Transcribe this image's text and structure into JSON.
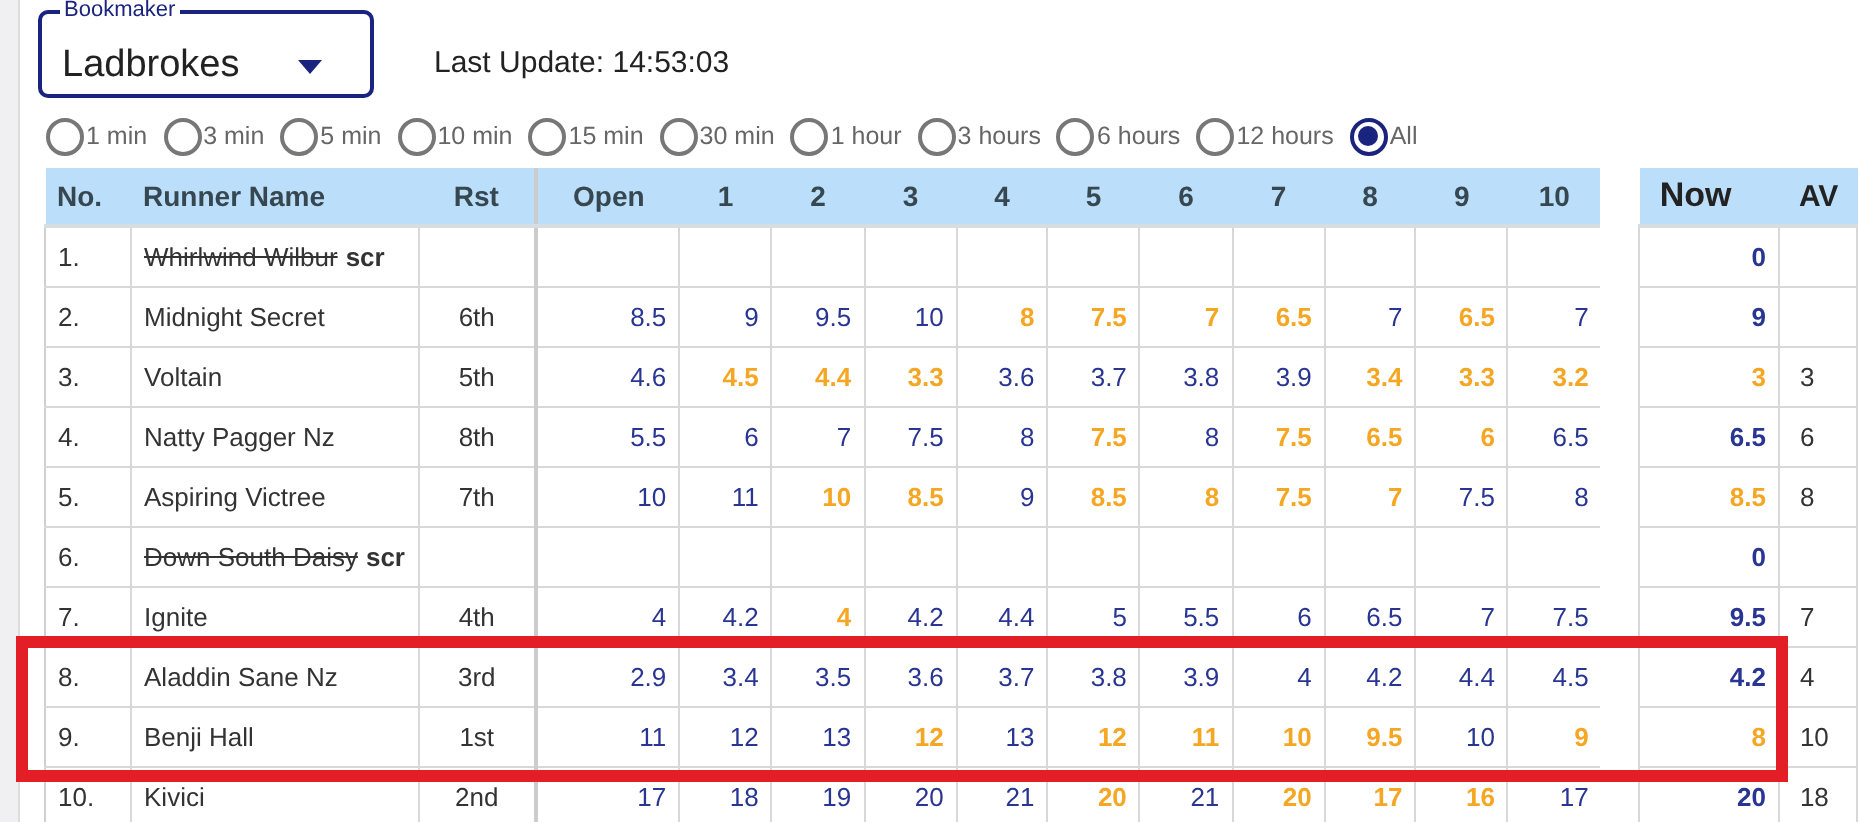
{
  "bookmaker": {
    "label": "Bookmaker",
    "value": "Ladbrokes"
  },
  "last_update": "Last Update: 14:53:03",
  "intervals": [
    {
      "label": "1 min",
      "selected": false
    },
    {
      "label": "3 min",
      "selected": false
    },
    {
      "label": "5 min",
      "selected": false
    },
    {
      "label": "10 min",
      "selected": false
    },
    {
      "label": "15 min",
      "selected": false
    },
    {
      "label": "30 min",
      "selected": false
    },
    {
      "label": "1 hour",
      "selected": false
    },
    {
      "label": "3 hours",
      "selected": false
    },
    {
      "label": "6 hours",
      "selected": false
    },
    {
      "label": "12 hours",
      "selected": false
    },
    {
      "label": "All",
      "selected": true
    }
  ],
  "table": {
    "columns": [
      "No.",
      "Runner Name",
      "Rst",
      "Open",
      "1",
      "2",
      "3",
      "4",
      "5",
      "6",
      "7",
      "8",
      "9",
      "10"
    ],
    "side_columns": [
      "Now",
      "AV"
    ],
    "rows": [
      {
        "no": "1.",
        "name": "Whirlwind Wilbur",
        "scratched": true,
        "scr_label": "scr",
        "rst": "",
        "odds": [],
        "now": {
          "text": "0",
          "highlighted": false
        },
        "av": ""
      },
      {
        "no": "2.",
        "name": "Midnight Secret",
        "scratched": false,
        "rst": "6th",
        "odds": [
          {
            "text": "8.5",
            "highlighted": false
          },
          {
            "text": "9",
            "highlighted": false
          },
          {
            "text": "9.5",
            "highlighted": false
          },
          {
            "text": "10",
            "highlighted": false
          },
          {
            "text": "8",
            "highlighted": true
          },
          {
            "text": "7.5",
            "highlighted": true
          },
          {
            "text": "7",
            "highlighted": true
          },
          {
            "text": "6.5",
            "highlighted": true
          },
          {
            "text": "7",
            "highlighted": false
          },
          {
            "text": "6.5",
            "highlighted": true
          },
          {
            "text": "7",
            "highlighted": false
          }
        ],
        "now": {
          "text": "9",
          "highlighted": false
        },
        "av": ""
      },
      {
        "no": "3.",
        "name": "Voltain",
        "scratched": false,
        "rst": "5th",
        "odds": [
          {
            "text": "4.6",
            "highlighted": false
          },
          {
            "text": "4.5",
            "highlighted": true
          },
          {
            "text": "4.4",
            "highlighted": true
          },
          {
            "text": "3.3",
            "highlighted": true
          },
          {
            "text": "3.6",
            "highlighted": false
          },
          {
            "text": "3.7",
            "highlighted": false
          },
          {
            "text": "3.8",
            "highlighted": false
          },
          {
            "text": "3.9",
            "highlighted": false
          },
          {
            "text": "3.4",
            "highlighted": true
          },
          {
            "text": "3.3",
            "highlighted": true
          },
          {
            "text": "3.2",
            "highlighted": true
          }
        ],
        "now": {
          "text": "3",
          "highlighted": true
        },
        "av": "3"
      },
      {
        "no": "4.",
        "name": "Natty Pagger Nz",
        "scratched": false,
        "rst": "8th",
        "odds": [
          {
            "text": "5.5",
            "highlighted": false
          },
          {
            "text": "6",
            "highlighted": false
          },
          {
            "text": "7",
            "highlighted": false
          },
          {
            "text": "7.5",
            "highlighted": false
          },
          {
            "text": "8",
            "highlighted": false
          },
          {
            "text": "7.5",
            "highlighted": true
          },
          {
            "text": "8",
            "highlighted": false
          },
          {
            "text": "7.5",
            "highlighted": true
          },
          {
            "text": "6.5",
            "highlighted": true
          },
          {
            "text": "6",
            "highlighted": true
          },
          {
            "text": "6.5",
            "highlighted": false
          }
        ],
        "now": {
          "text": "6.5",
          "highlighted": false
        },
        "av": "6"
      },
      {
        "no": "5.",
        "name": "Aspiring Victree",
        "scratched": false,
        "rst": "7th",
        "odds": [
          {
            "text": "10",
            "highlighted": false
          },
          {
            "text": "11",
            "highlighted": false
          },
          {
            "text": "10",
            "highlighted": true
          },
          {
            "text": "8.5",
            "highlighted": true
          },
          {
            "text": "9",
            "highlighted": false
          },
          {
            "text": "8.5",
            "highlighted": true
          },
          {
            "text": "8",
            "highlighted": true
          },
          {
            "text": "7.5",
            "highlighted": true
          },
          {
            "text": "7",
            "highlighted": true
          },
          {
            "text": "7.5",
            "highlighted": false
          },
          {
            "text": "8",
            "highlighted": false
          }
        ],
        "now": {
          "text": "8.5",
          "highlighted": true
        },
        "av": "8"
      },
      {
        "no": "6.",
        "name": "Down South Daisy",
        "scratched": true,
        "scr_label": "scr",
        "rst": "",
        "odds": [],
        "now": {
          "text": "0",
          "highlighted": false
        },
        "av": ""
      },
      {
        "no": "7.",
        "name": "Ignite",
        "scratched": false,
        "rst": "4th",
        "odds": [
          {
            "text": "4",
            "highlighted": false
          },
          {
            "text": "4.2",
            "highlighted": false
          },
          {
            "text": "4",
            "highlighted": true
          },
          {
            "text": "4.2",
            "highlighted": false
          },
          {
            "text": "4.4",
            "highlighted": false
          },
          {
            "text": "5",
            "highlighted": false
          },
          {
            "text": "5.5",
            "highlighted": false
          },
          {
            "text": "6",
            "highlighted": false
          },
          {
            "text": "6.5",
            "highlighted": false
          },
          {
            "text": "7",
            "highlighted": false
          },
          {
            "text": "7.5",
            "highlighted": false
          }
        ],
        "now": {
          "text": "9.5",
          "highlighted": false
        },
        "av": "7"
      },
      {
        "no": "8.",
        "name": "Aladdin Sane Nz",
        "scratched": false,
        "rst": "3rd",
        "odds": [
          {
            "text": "2.9",
            "highlighted": false
          },
          {
            "text": "3.4",
            "highlighted": false
          },
          {
            "text": "3.5",
            "highlighted": false
          },
          {
            "text": "3.6",
            "highlighted": false
          },
          {
            "text": "3.7",
            "highlighted": false
          },
          {
            "text": "3.8",
            "highlighted": false
          },
          {
            "text": "3.9",
            "highlighted": false
          },
          {
            "text": "4",
            "highlighted": false
          },
          {
            "text": "4.2",
            "highlighted": false
          },
          {
            "text": "4.4",
            "highlighted": false
          },
          {
            "text": "4.5",
            "highlighted": false
          }
        ],
        "now": {
          "text": "4.2",
          "highlighted": false
        },
        "av": "4"
      },
      {
        "no": "9.",
        "name": "Benji Hall",
        "scratched": false,
        "rst": "1st",
        "odds": [
          {
            "text": "11",
            "highlighted": false
          },
          {
            "text": "12",
            "highlighted": false
          },
          {
            "text": "13",
            "highlighted": false
          },
          {
            "text": "12",
            "highlighted": true
          },
          {
            "text": "13",
            "highlighted": false
          },
          {
            "text": "12",
            "highlighted": true
          },
          {
            "text": "11",
            "highlighted": true
          },
          {
            "text": "10",
            "highlighted": true
          },
          {
            "text": "9.5",
            "highlighted": true
          },
          {
            "text": "10",
            "highlighted": false
          },
          {
            "text": "9",
            "highlighted": true
          }
        ],
        "now": {
          "text": "8",
          "highlighted": true
        },
        "av": "10"
      },
      {
        "no": "10.",
        "name": "Kivici",
        "scratched": false,
        "rst": "2nd",
        "odds": [
          {
            "text": "17",
            "highlighted": false
          },
          {
            "text": "18",
            "highlighted": false
          },
          {
            "text": "19",
            "highlighted": false
          },
          {
            "text": "20",
            "highlighted": false
          },
          {
            "text": "21",
            "highlighted": false
          },
          {
            "text": "20",
            "highlighted": true
          },
          {
            "text": "21",
            "highlighted": false
          },
          {
            "text": "20",
            "highlighted": true
          },
          {
            "text": "17",
            "highlighted": true
          },
          {
            "text": "16",
            "highlighted": true
          },
          {
            "text": "17",
            "highlighted": false
          }
        ],
        "now": {
          "text": "20",
          "highlighted": false
        },
        "av": "18"
      }
    ]
  }
}
